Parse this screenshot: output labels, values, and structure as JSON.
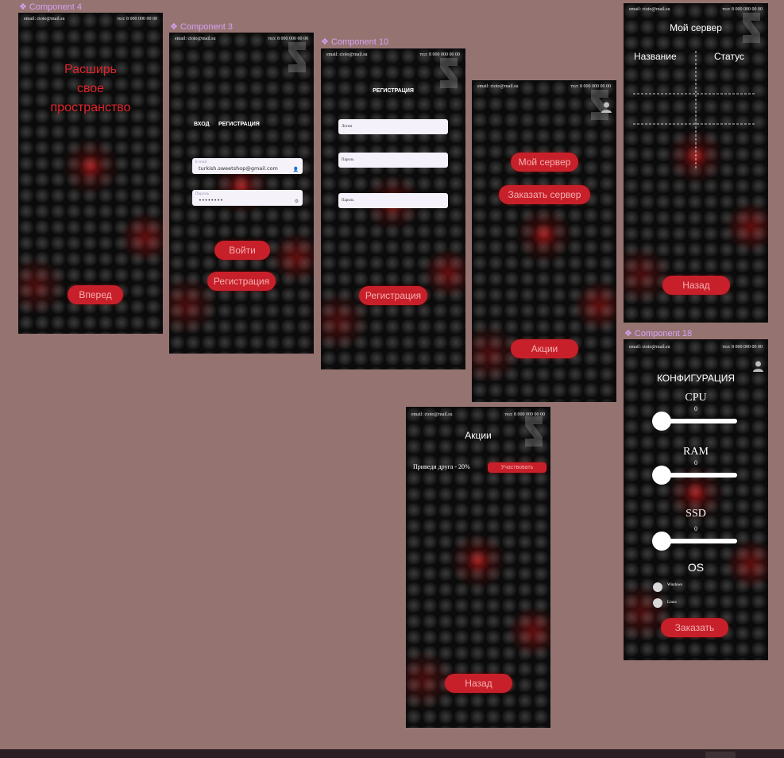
{
  "labels": {
    "c4": "❖ Component 4",
    "c3": "❖ Component 3",
    "c10": "❖ Component 10",
    "c18": "❖ Component 18"
  },
  "topbar": {
    "email": "email: ctoto@mail.su",
    "phone": "тел: 8 000 000 00 00"
  },
  "screen1": {
    "headline": [
      "Расширь",
      "свое",
      "пространство"
    ],
    "forward": "Вперед"
  },
  "screen2": {
    "tab_login": "ВХОД",
    "tab_register": "РЕГИСТРАЦИЯ",
    "email_placeholder": "E-mail",
    "email_value": "turkish.sweetshop@gmail.com",
    "password_placeholder": "Пароль",
    "password_value": "••••••••",
    "login_btn": "Войти",
    "register_btn": "Регистрация"
  },
  "screen3": {
    "title": "РЕГИСТРАЦИЯ",
    "login_field": "Логин",
    "password_field": "Пароль",
    "password_field2": "Пароль",
    "register_btn": "Регистрация"
  },
  "screen4": {
    "my_server": "Мой сервер",
    "order_server": "Заказать сервер",
    "promos": "Акции"
  },
  "screen5": {
    "title": "Мой сервер",
    "col_name": "Название",
    "col_status": "Статус",
    "back": "Назад"
  },
  "screen6": {
    "title": "Акции",
    "promo_text": "Приведи друга - 20%",
    "participate": "Участвовать",
    "back": "Назад"
  },
  "screen7": {
    "title": "КОНФИГУРАЦИЯ",
    "cpu_label": "CPU",
    "cpu_value": "0",
    "ram_label": "RAM",
    "ram_value": "0",
    "ssd_label": "SSD",
    "ssd_value": "0",
    "os_label": "OS",
    "os_windows": "Windows",
    "os_linux": "Linux",
    "order": "Заказать"
  },
  "colors": {
    "accent": "#c8202a",
    "canvas": "#957371",
    "label": "#d7a2f5"
  }
}
